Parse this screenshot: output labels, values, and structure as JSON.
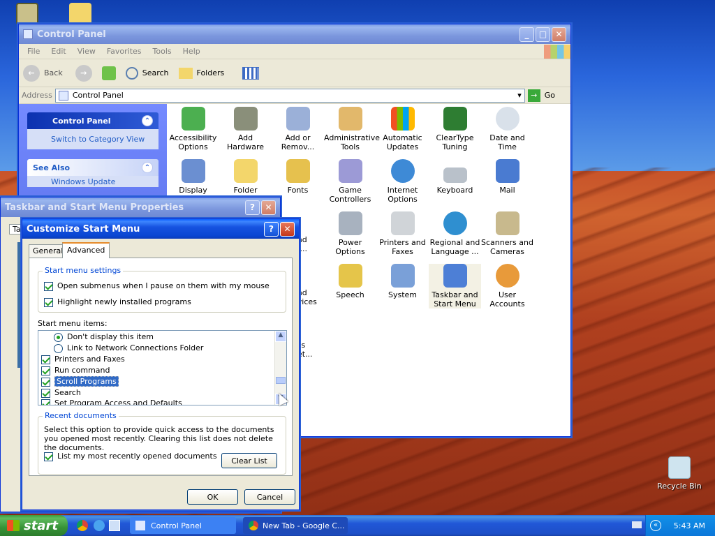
{
  "desktop": {
    "recycle_bin": "Recycle Bin"
  },
  "control_panel": {
    "title": "Control Panel",
    "menu": [
      "File",
      "Edit",
      "View",
      "Favorites",
      "Tools",
      "Help"
    ],
    "toolbar": {
      "back": "Back",
      "search": "Search",
      "folders": "Folders"
    },
    "address_label": "Address",
    "address_value": "Control Panel",
    "go": "Go",
    "task_pane": {
      "heading": "Control Panel",
      "switch_link": "Switch to Category View",
      "see_also": "See Also",
      "see_also_item": "Windows Update"
    },
    "items": [
      {
        "label": "Accessibility Options"
      },
      {
        "label": "Add Hardware"
      },
      {
        "label": "Add or Remov..."
      },
      {
        "label": "Administrative Tools"
      },
      {
        "label": "Automatic Updates"
      },
      {
        "label": "ClearType Tuning"
      },
      {
        "label": "Date and Time"
      },
      {
        "label": "Display"
      },
      {
        "label": "Folder Options"
      },
      {
        "label": "Fonts"
      },
      {
        "label": "Game Controllers"
      },
      {
        "label": "Internet Options"
      },
      {
        "label": "Keyboard"
      },
      {
        "label": "Mail"
      },
      {
        "label": "Power Options"
      },
      {
        "label": "Printers and Faxes"
      },
      {
        "label": "Regional and Language ..."
      },
      {
        "label": "Scanners and Cameras"
      },
      {
        "label": "Speech"
      },
      {
        "label": "System"
      },
      {
        "label": "Taskbar and Start Menu"
      },
      {
        "label": "User Accounts"
      }
    ],
    "partial": {
      "row3a": "and",
      "row3b": "n ...",
      "row4a": "and",
      "row4b": "evices",
      "row5a": "ess",
      "row5b": "Set..."
    }
  },
  "taskbar_props": {
    "title": "Taskbar and Start Menu Properties",
    "tab_fragment": "Ta"
  },
  "customize": {
    "title": "Customize Start Menu",
    "tabs": [
      "General",
      "Advanced"
    ],
    "settings_group": "Start menu settings",
    "settings": [
      {
        "label": "Open submenus when I pause on them with my mouse",
        "checked": true
      },
      {
        "label": "Highlight newly installed programs",
        "checked": true
      }
    ],
    "items_label": "Start menu items:",
    "items": [
      {
        "label": "Don't display this item",
        "type": "radio",
        "checked": true
      },
      {
        "label": "Link to Network Connections Folder",
        "type": "radio",
        "checked": false
      },
      {
        "label": "Printers and Faxes",
        "type": "check",
        "checked": true
      },
      {
        "label": "Run command",
        "type": "check",
        "checked": true
      },
      {
        "label": "Scroll Programs",
        "type": "check",
        "checked": true,
        "selected": true
      },
      {
        "label": "Search",
        "type": "check",
        "checked": true
      },
      {
        "label": "Set Program Access and Defaults",
        "type": "check",
        "checked": true
      }
    ],
    "recent_group": "Recent documents",
    "recent_text": "Select this option to provide quick access to the documents you opened most recently.  Clearing this list does not delete the documents.",
    "recent_check": "List my most recently opened documents",
    "clear_list": "Clear List",
    "ok": "OK",
    "cancel": "Cancel"
  },
  "taskbar": {
    "start": "start",
    "items": [
      "Control Panel",
      "New Tab - Google C..."
    ],
    "clock": "5:43 AM"
  }
}
